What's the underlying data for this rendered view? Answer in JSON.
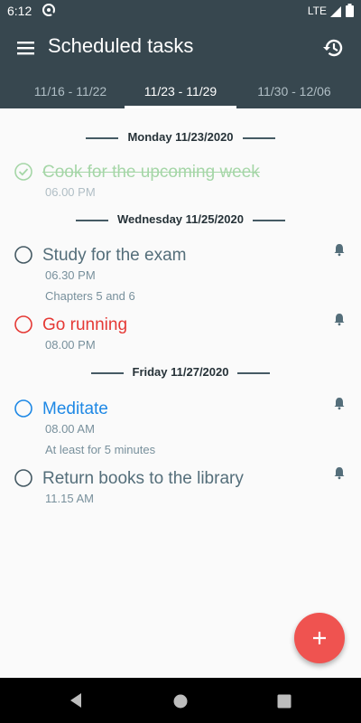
{
  "status": {
    "time": "6:12",
    "network": "LTE"
  },
  "appbar": {
    "title": "Scheduled tasks"
  },
  "tabs": [
    {
      "label": "11/16 - 11/22",
      "active": false
    },
    {
      "label": "11/23 - 11/29",
      "active": true
    },
    {
      "label": "11/30 - 12/06",
      "active": false
    }
  ],
  "days": [
    {
      "label": "Monday 11/23/2020",
      "tasks": [
        {
          "name": "Cook for the upcoming week",
          "time": "06.00 PM",
          "note": "",
          "status": "done",
          "color": "#a5d6a7"
        }
      ]
    },
    {
      "label": "Wednesday 11/25/2020",
      "tasks": [
        {
          "name": "Study for the exam",
          "time": "06.30 PM",
          "note": "Chapters 5 and 6",
          "status": "open",
          "color": "#546e7a"
        },
        {
          "name": "Go running",
          "time": "08.00 PM",
          "note": "",
          "status": "open",
          "color": "#e53935"
        }
      ]
    },
    {
      "label": "Friday 11/27/2020",
      "tasks": [
        {
          "name": "Meditate",
          "time": "08.00 AM",
          "note": "At least for 5 minutes",
          "status": "open",
          "color": "#1e88e5"
        },
        {
          "name": "Return books to the library",
          "time": "11.15 AM",
          "note": "",
          "status": "open",
          "color": "#546e7a"
        }
      ]
    }
  ],
  "colors": {
    "appbar": "#37474f",
    "fab": "#ef5350",
    "done": "#a5d6a7",
    "overdue": "#e53935",
    "highlight": "#1e88e5"
  },
  "icons": {
    "menu": "hamburger-icon",
    "history": "history-icon",
    "reminder": "bell-icon",
    "add": "plus-icon"
  }
}
